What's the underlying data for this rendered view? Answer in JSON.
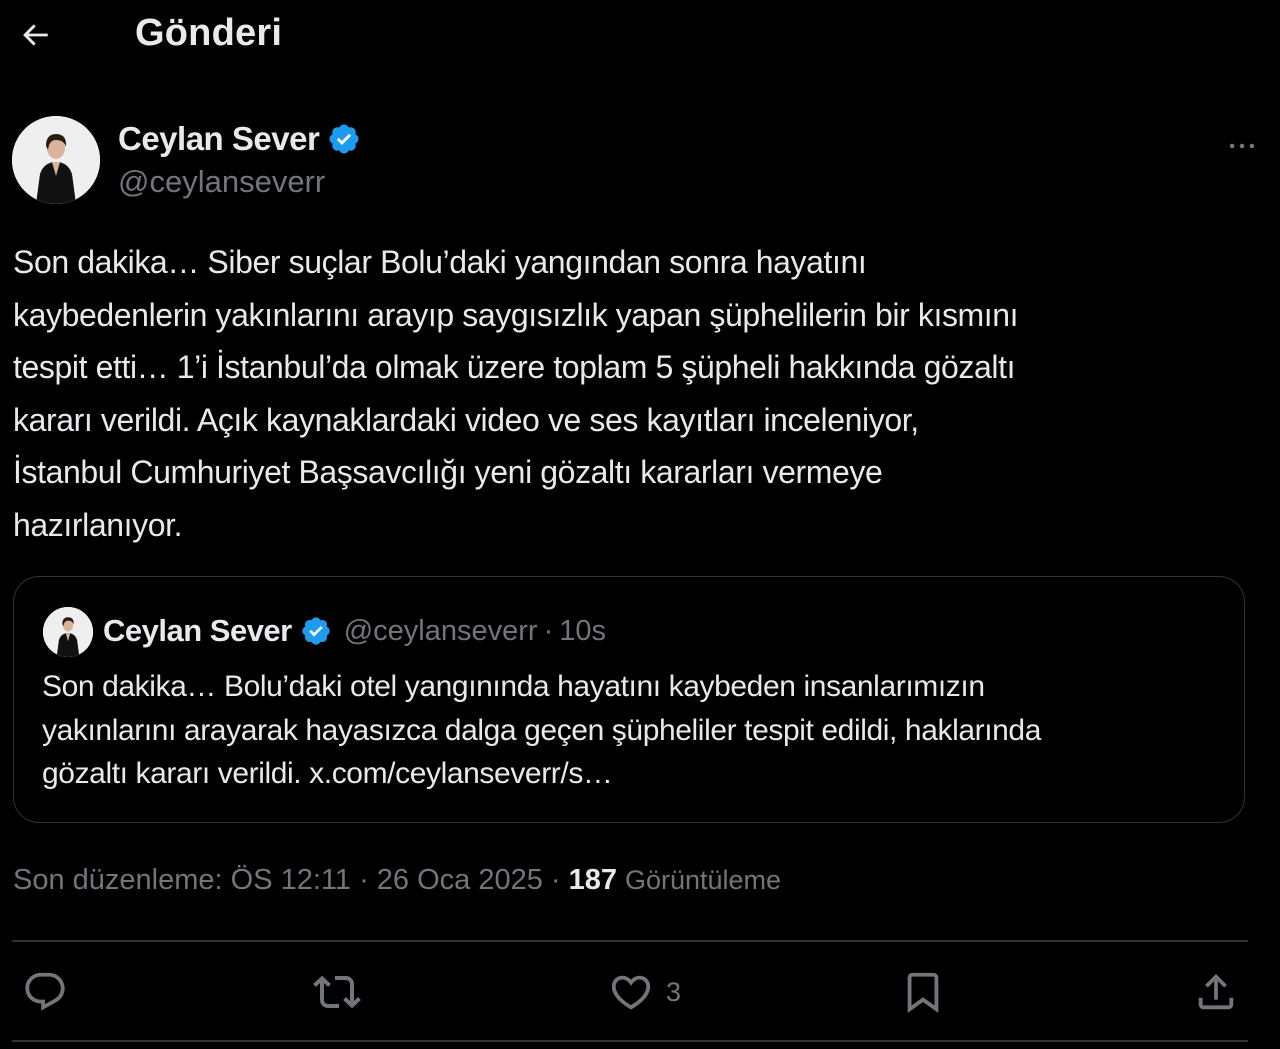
{
  "header": {
    "title": "Gönderi",
    "back_icon": "arrow-left-icon"
  },
  "author": {
    "display_name": "Ceylan Sever",
    "handle": "@ceylanseverr",
    "verified": true,
    "verified_color": "#1d9bf0"
  },
  "tweet": {
    "text_lines": [
      "Son dakika… Siber suçlar Bolu’daki yangından sonra hayatını",
      "kaybedenlerin yakınlarını arayıp saygısızlık yapan şüphelilerin bir kısmını",
      "tespit etti… 1’i İstanbul’da olmak üzere toplam 5 şüpheli hakkında gözaltı",
      "kararı verildi. Açık kaynaklardaki video ve ses kayıtları inceleniyor,",
      "İstanbul Cumhuriyet Başsavcılığı yeni gözaltı kararları vermeye",
      "hazırlanıyor."
    ]
  },
  "quote": {
    "display_name": "Ceylan Sever",
    "handle": "@ceylanseverr",
    "separator": "·",
    "time": "10s",
    "text_lines": [
      "Son dakika… Bolu’daki otel yangınında hayatını kaybeden insanlarımızın",
      "yakınlarını arayarak hayasızca dalga geçen şüpheliler tespit edildi, haklarında",
      "gözaltı kararı verildi. x.com/ceylanseverr/s…"
    ]
  },
  "meta": {
    "edited_label": "Son düzenleme: ÖS 12:11 · 26 Oca 2025 ·",
    "views_count": "187",
    "views_label": "Görüntüleme"
  },
  "actions": {
    "reply_icon": "reply-icon",
    "retweet_icon": "retweet-icon",
    "like_icon": "heart-icon",
    "like_count": "3",
    "bookmark_icon": "bookmark-icon",
    "share_icon": "share-icon"
  },
  "colors": {
    "background": "#000000",
    "text": "#e7e9ea",
    "secondary": "#71767b",
    "border": "#2f3336",
    "accent": "#1d9bf0"
  }
}
